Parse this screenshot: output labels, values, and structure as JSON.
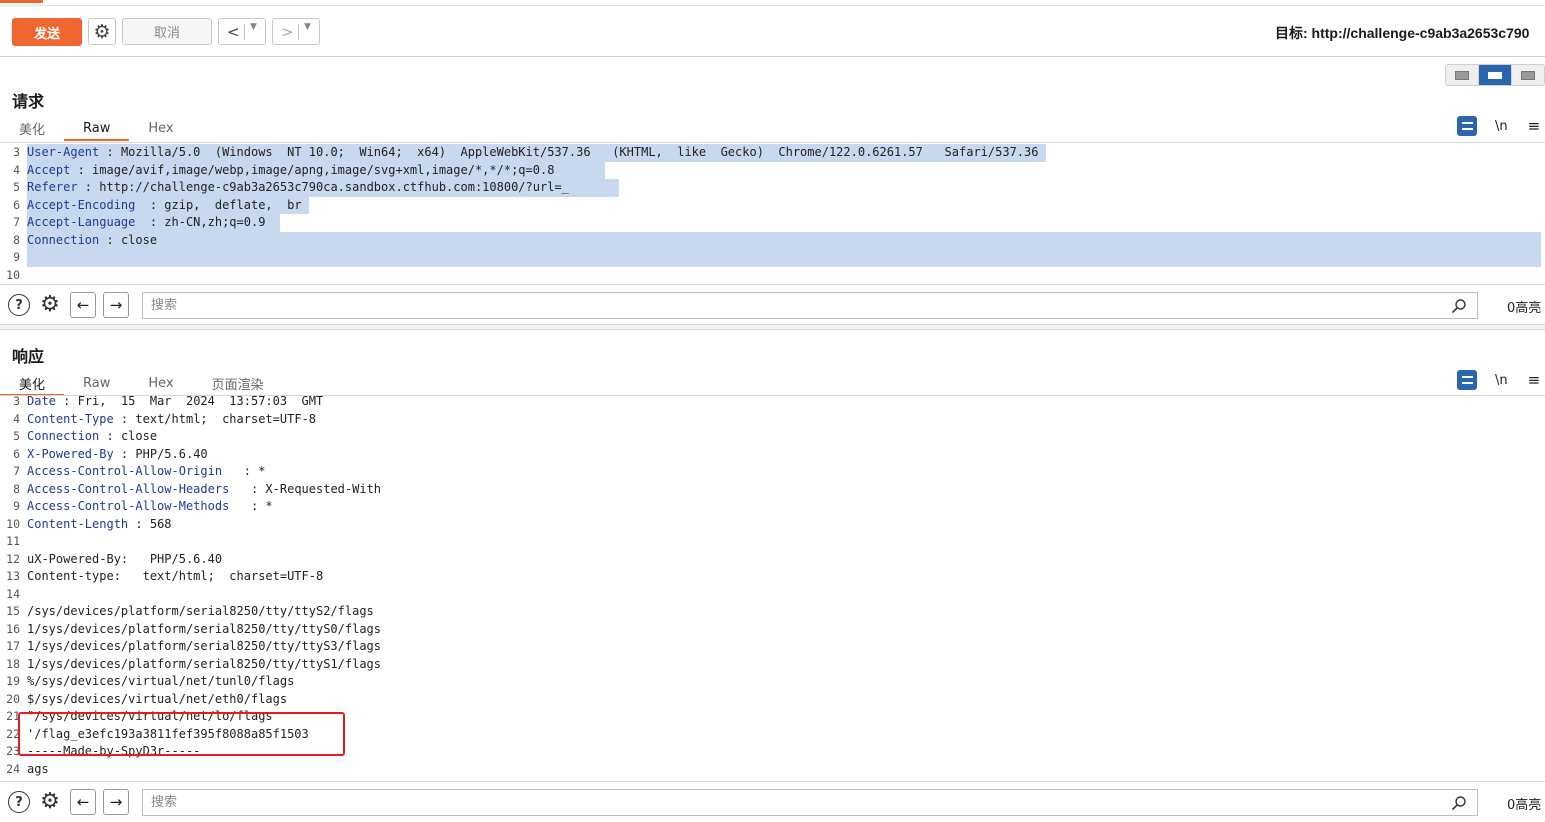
{
  "toolbar": {
    "send_label": "发送",
    "cancel_label": "取消",
    "target_label": "目标: http://challenge-c9ab3a2653c790"
  },
  "request": {
    "title": "请求",
    "tabs": [
      "美化",
      "Raw",
      "Hex"
    ],
    "active_tab": "Raw",
    "newline_label": "\\n",
    "lines": [
      {
        "n": "3",
        "key": "User-Agent",
        "sep": " : ",
        "val": "Mozilla/5.0  (Windows  NT 10.0;  Win64;  x64)  AppleWebKit/537.36   (KHTML,  like  Gecko)  Chrome/122.0.6261.57   Safari/537.36 ",
        "sel": true
      },
      {
        "n": "4",
        "key": "Accept",
        "sep": " : ",
        "val": "image/avif,image/webp,image/apng,image/svg+xml,image/*,*/*;q=0.8       ",
        "sel": true
      },
      {
        "n": "5",
        "key": "Referer",
        "sep": " : ",
        "val": "http://challenge-c9ab3a2653c790ca.sandbox.ctfhub.com:10800/?url=_       ",
        "sel": true
      },
      {
        "n": "6",
        "key": "Accept-Encoding",
        "sep": "  : ",
        "val": "gzip,  deflate,  br ",
        "sel": true
      },
      {
        "n": "7",
        "key": "Accept-Language",
        "sep": "  : ",
        "val": "zh-CN,zh;q=0.9  ",
        "sel": true
      },
      {
        "n": "8",
        "key": "Connection",
        "sep": " : ",
        "val": "close",
        "sel": true,
        "full": true
      },
      {
        "n": "9",
        "key": "",
        "sep": "",
        "val": "",
        "sel": true,
        "full": true
      },
      {
        "n": "10",
        "key": "",
        "sep": "",
        "val": "",
        "sel": false
      }
    ],
    "search_placeholder": "搜索",
    "highlight_count": "0高亮"
  },
  "response": {
    "title": "响应",
    "tabs": [
      "美化",
      "Raw",
      "Hex",
      "页面渲染"
    ],
    "active_tab": "美化",
    "newline_label": "\\n",
    "lines": [
      {
        "n": "3",
        "key": "Date",
        "sep": " : ",
        "val": "Fri,  15  Mar  2024  13:57:03  GMT"
      },
      {
        "n": "4",
        "key": "Content-Type",
        "sep": " : ",
        "val": "text/html;  charset=UTF-8"
      },
      {
        "n": "5",
        "key": "Connection",
        "sep": " : ",
        "val": "close"
      },
      {
        "n": "6",
        "key": "X-Powered-By",
        "sep": " : ",
        "val": "PHP/5.6.40"
      },
      {
        "n": "7",
        "key": "Access-Control-Allow-Origin",
        "sep": "   : ",
        "val": "*"
      },
      {
        "n": "8",
        "key": "Access-Control-Allow-Headers",
        "sep": "   : ",
        "val": "X-Requested-With"
      },
      {
        "n": "9",
        "key": "Access-Control-Allow-Methods",
        "sep": "   : ",
        "val": "*"
      },
      {
        "n": "10",
        "key": "Content-Length",
        "sep": " : ",
        "val": "568"
      },
      {
        "n": "11",
        "key": "",
        "sep": "",
        "val": ""
      },
      {
        "n": "12",
        "key": "",
        "sep": "",
        "val": "uX-Powered-By:   PHP/5.6.40"
      },
      {
        "n": "13",
        "key": "",
        "sep": "",
        "val": "Content-type:   text/html;  charset=UTF-8"
      },
      {
        "n": "14",
        "key": "",
        "sep": "",
        "val": ""
      },
      {
        "n": "15",
        "key": "",
        "sep": "",
        "val": "/sys/devices/platform/serial8250/tty/ttyS2/flags"
      },
      {
        "n": "16",
        "key": "",
        "sep": "",
        "val": "1/sys/devices/platform/serial8250/tty/ttyS0/flags"
      },
      {
        "n": "17",
        "key": "",
        "sep": "",
        "val": "1/sys/devices/platform/serial8250/tty/ttyS3/flags"
      },
      {
        "n": "18",
        "key": "",
        "sep": "",
        "val": "1/sys/devices/platform/serial8250/tty/ttyS1/flags"
      },
      {
        "n": "19",
        "key": "",
        "sep": "",
        "val": "%/sys/devices/virtual/net/tunl0/flags"
      },
      {
        "n": "20",
        "key": "",
        "sep": "",
        "val": "$/sys/devices/virtual/net/eth0/flags"
      },
      {
        "n": "21",
        "key": "",
        "sep": "",
        "val": "\"/sys/devices/virtual/net/lo/flags"
      },
      {
        "n": "22",
        "key": "",
        "sep": "",
        "val": "'/flag_e3efc193a3811fef395f8088a85f1503"
      },
      {
        "n": "23",
        "key": "",
        "sep": "",
        "val": "-----Made-by-SpyD3r-----"
      },
      {
        "n": "24",
        "key": "",
        "sep": "",
        "val": "ags"
      }
    ],
    "search_placeholder": "搜索",
    "highlight_count": "0高亮"
  },
  "icons": {
    "help": "question-circle-icon",
    "settings": "gear-icon",
    "prev": "arrow-left-icon",
    "next": "arrow-right-icon",
    "search": "magnifier-icon"
  },
  "colors": {
    "accent": "#ef6630",
    "key_text": "#1f3a9a",
    "selection": "#c8d8ef",
    "highlight_box": "#e41e1e",
    "active_toggle": "#2a66b0"
  }
}
